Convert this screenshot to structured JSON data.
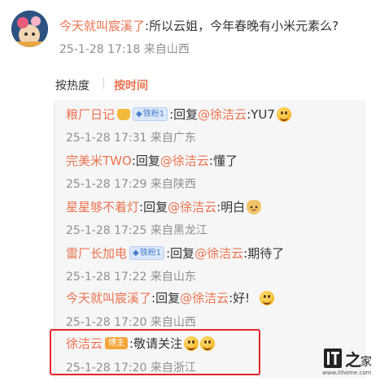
{
  "post": {
    "username": "今天就叫宸溪了",
    "text": ":所以云姐，今年春晚有小米元素么?",
    "meta": "25-1-28 17:18 来自山西"
  },
  "sort": {
    "hot_label": "按热度",
    "time_label": "按时间",
    "active": "按时间"
  },
  "replies": [
    {
      "username": "粮厂日记",
      "badge": "铁粉1",
      "reply_prefix": ":回复",
      "mention": "@徐洁云",
      "text": ":YU7",
      "meta": "25-1-28 17:31 来自广东"
    },
    {
      "username": "完美米TWO",
      "reply_prefix": ":回复",
      "mention": "@徐洁云",
      "text": ":懂了",
      "meta": "25-1-28 17:29 来自陕西"
    },
    {
      "username": "星星够不着灯",
      "reply_prefix": ":回复",
      "mention": "@徐洁云",
      "text": ":明白",
      "meta": "25-1-28 17:25 来自黑龙江"
    },
    {
      "username": "雷厂长加电",
      "badge": "铁粉1",
      "reply_prefix": ":回复",
      "mention": "@徐洁云",
      "text": ":期待了",
      "meta": "25-1-28 17:22 来自山东"
    },
    {
      "username": "今天就叫宸溪了",
      "reply_prefix": ":回复",
      "mention": "@徐洁云",
      "text": ":好!",
      "meta": "25-1-28 17:20 来自山西"
    },
    {
      "username": "徐洁云",
      "badge": "博主",
      "text": ":敬请关注",
      "meta": "25-1-28 17:20 来自浙江"
    }
  ],
  "watermark": {
    "logo_text": "IT之家",
    "url": "www.ithome.com"
  },
  "colors": {
    "username": "#eb7350",
    "highlight_border": "#e8252a",
    "panel_bg": "#f6f6f6"
  }
}
